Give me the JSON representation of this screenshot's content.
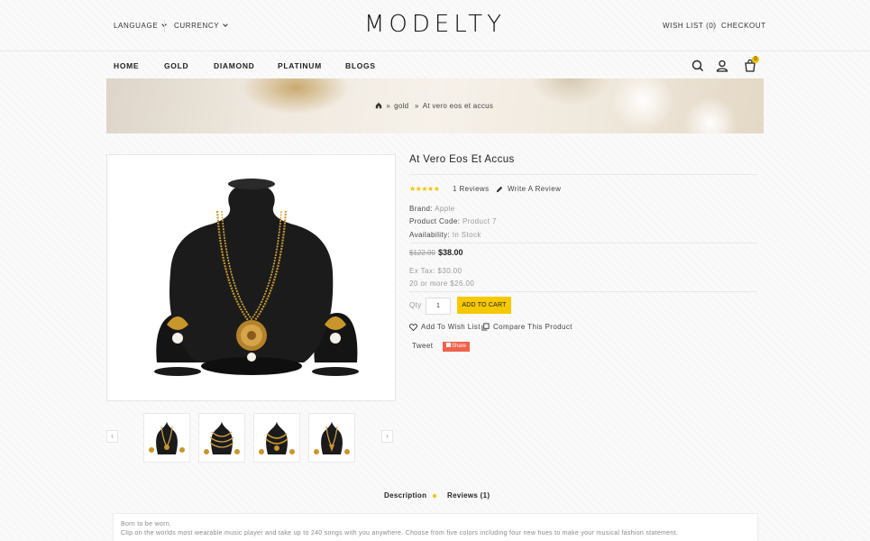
{
  "topbar": {
    "language": "LANGUAGE",
    "currency": "CURRENCY",
    "wishlist": "WISH LIST (0)",
    "checkout": "CHECKOUT"
  },
  "brand": {
    "logo": "MODELTY"
  },
  "nav": {
    "items": [
      "HOME",
      "GOLD",
      "DIAMOND",
      "PLATINUM",
      "BLOGS"
    ],
    "cart_count": "0"
  },
  "breadcrumb": {
    "home_icon": "home-icon",
    "items": [
      "gold",
      "At vero eos et accus"
    ]
  },
  "product": {
    "title": "At Vero Eos Et Accus",
    "rating": 5,
    "reviews_link": "1 Reviews",
    "write_review": "Write A Review",
    "brand_label": "Brand:",
    "brand_value": "Apple",
    "code_label": "Product Code:",
    "code_value": "Product 7",
    "avail_label": "Availability:",
    "avail_value": "In Stock",
    "old_price": "$122.00",
    "price": "$38.00",
    "ex_tax": "Ex Tax: $30.00",
    "discount": "20 or more $26.00",
    "qty_label": "Qty",
    "qty_value": "1",
    "add_to_cart": "ADD TO CART",
    "wishlist": "Add To Wish List",
    "compare": "Compare This Product",
    "tweet": "Tweet",
    "share": "Share"
  },
  "tabs": [
    "Description",
    "Reviews (1)"
  ],
  "description": {
    "heading": "Born to be worn.",
    "text": "Clip on the worlds most wearable music player and take up to 240 songs with you anywhere. Choose from five colors including four new hues to make your musical fashion statement."
  },
  "colors": {
    "accent": "#f5c800",
    "share": "#f0624c"
  }
}
